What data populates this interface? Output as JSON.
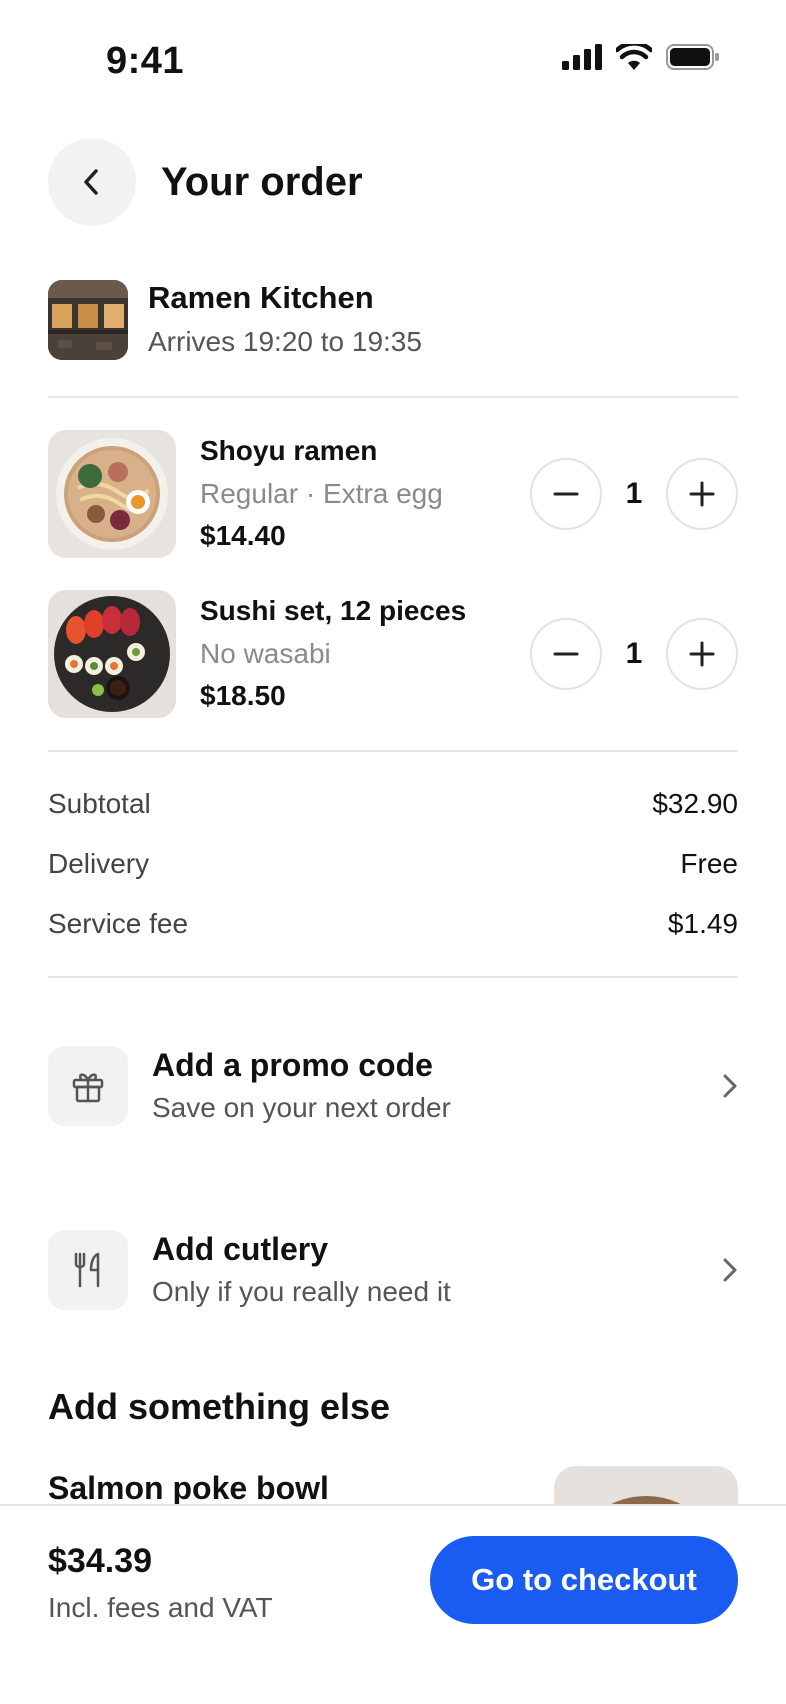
{
  "status_bar": {
    "time": "9:41"
  },
  "header": {
    "title": "Your order"
  },
  "restaurant": {
    "name": "Ramen Kitchen",
    "eta": "Arrives 19:20 to 19:35"
  },
  "items": [
    {
      "name": "Shoyu ramen",
      "options": "Regular · Extra egg",
      "price": "$14.40",
      "quantity": "1"
    },
    {
      "name": "Sushi set, 12 pieces",
      "options": "No wasabi",
      "price": "$18.50",
      "quantity": "1"
    }
  ],
  "summary": {
    "rows": [
      {
        "label": "Subtotal",
        "value": "$32.90"
      },
      {
        "label": "Delivery",
        "value": "Free"
      },
      {
        "label": "Service fee",
        "value": "$1.49"
      }
    ]
  },
  "actions": [
    {
      "title": "Add a promo code",
      "subtitle": "Save on your next order",
      "icon": "gift-icon"
    },
    {
      "title": "Add cutlery",
      "subtitle": "Only if you really need it",
      "icon": "cutlery-icon"
    }
  ],
  "recommendations": {
    "title": "Add something else",
    "first_item": "Salmon poke bowl"
  },
  "footer": {
    "total": "$34.39",
    "note": "Incl. fees and VAT",
    "checkout_label": "Go to checkout"
  },
  "colors": {
    "accent": "#1a5cf2",
    "surface": "#f2f2f2",
    "divider": "#e6e6e6",
    "muted_text": "#8a8a8a"
  }
}
